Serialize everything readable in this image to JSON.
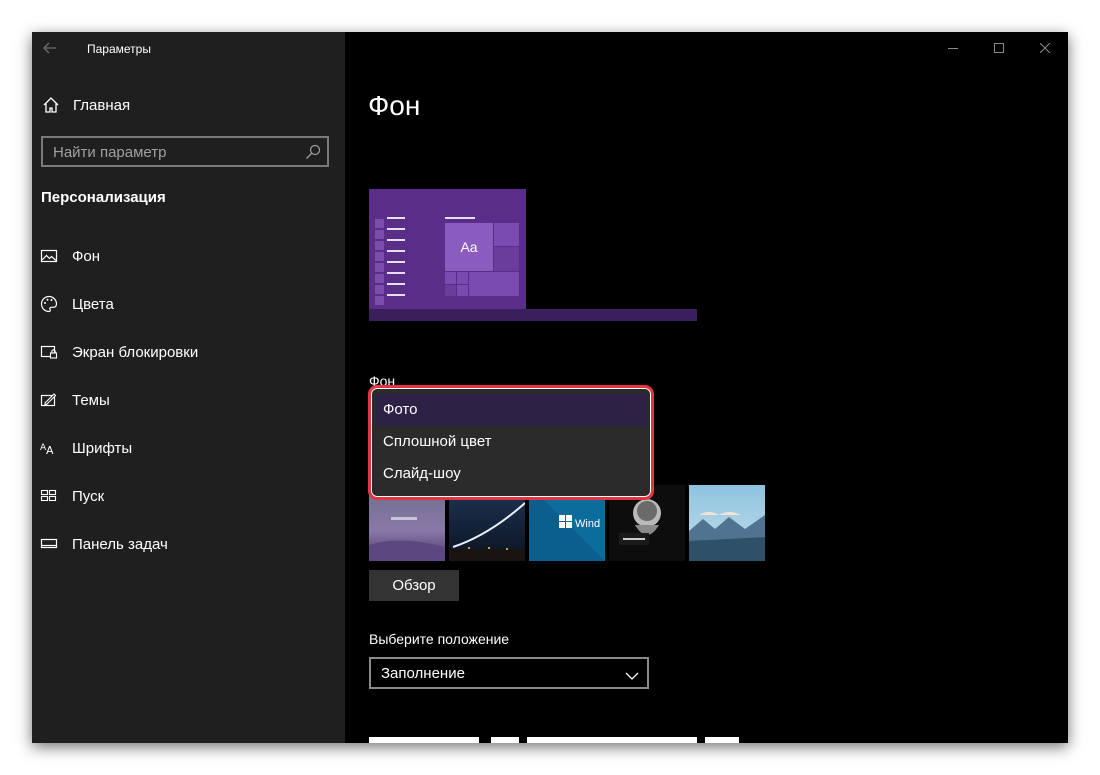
{
  "window": {
    "title": "Параметры"
  },
  "sidebar": {
    "home_label": "Главная",
    "search_placeholder": "Найти параметр",
    "section_title": "Персонализация",
    "items": [
      {
        "label": "Фон",
        "icon": "picture-icon"
      },
      {
        "label": "Цвета",
        "icon": "palette-icon"
      },
      {
        "label": "Экран блокировки",
        "icon": "lock-screen-icon"
      },
      {
        "label": "Темы",
        "icon": "themes-icon"
      },
      {
        "label": "Шрифты",
        "icon": "fonts-icon"
      },
      {
        "label": "Пуск",
        "icon": "start-icon"
      },
      {
        "label": "Панель задач",
        "icon": "taskbar-icon"
      }
    ]
  },
  "main": {
    "page_title": "Фон",
    "preview_tile_text": "Aa",
    "background_label": "Фон",
    "background_dropdown": {
      "selected": "Фото",
      "options": [
        "Фото",
        "Сплошной цвет",
        "Слайд-шоу"
      ]
    },
    "browse_label": "Обзор",
    "position_label": "Выберите положение",
    "position_value": "Заполнение"
  },
  "colors": {
    "sidebar_bg": "#1f1f1f",
    "main_bg": "#000000",
    "accent_purple": "#5a2d88",
    "highlight_red": "#e4343f"
  }
}
